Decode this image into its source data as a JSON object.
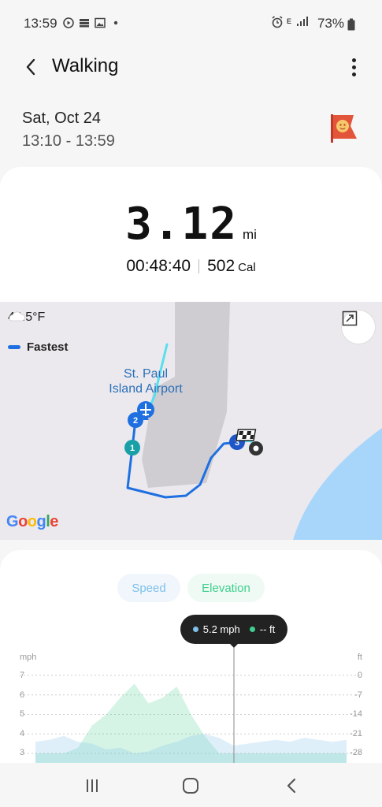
{
  "status_bar": {
    "time": "13:59",
    "battery": "73%",
    "network": "E"
  },
  "app_bar": {
    "title": "Walking"
  },
  "workout": {
    "date": "Sat, Oct 24",
    "time_range": "13:10 - 13:59",
    "distance": "3.12",
    "distance_unit": "mi",
    "duration": "00:48:40",
    "calories": "502",
    "calories_unit": "Cal"
  },
  "map": {
    "weather": "44.5°F",
    "legend_label": "Fastest",
    "airport_label_line1": "St. Paul",
    "airport_label_line2": "Island Airport",
    "markers": [
      "1",
      "2",
      "3"
    ],
    "google_logo": "Google"
  },
  "chart": {
    "tabs": [
      "Speed",
      "Elevation"
    ],
    "tooltip_speed": "5.2 mph",
    "tooltip_elevation": "-- ft",
    "left_axis_title": "mph",
    "right_axis_title": "ft",
    "left_ticks": [
      "7",
      "6",
      "5",
      "4",
      "3"
    ],
    "right_ticks": [
      "0",
      "-7",
      "-14",
      "-21",
      "-28"
    ],
    "colors": {
      "speed": "#7ec0ea",
      "elevation": "#3fcf8e"
    }
  },
  "chart_data": {
    "type": "area",
    "title": "",
    "series": [
      {
        "name": "Speed",
        "values": [
          3.6,
          3.7,
          3.9,
          3.6,
          3.5,
          3.2,
          3.3,
          3.0,
          3.1,
          3.4,
          3.6,
          3.9,
          4.0,
          3.8,
          3.4,
          3.5,
          3.6,
          3.7,
          3.6,
          3.8,
          3.7,
          3.6,
          3.7
        ]
      },
      {
        "name": "Elevation",
        "values": [
          -28,
          -28,
          -28,
          -26,
          -18,
          -14,
          -8,
          -3,
          -10,
          -8,
          -4,
          -14,
          -22,
          -28,
          -28,
          -28,
          -28,
          -28,
          -28,
          -28,
          -28,
          -28,
          -28
        ]
      }
    ],
    "ylim_left": [
      3,
      7
    ],
    "ylim_right": [
      -28,
      0
    ]
  },
  "nav": {
    "recents": "recents",
    "home": "home",
    "back": "back"
  }
}
